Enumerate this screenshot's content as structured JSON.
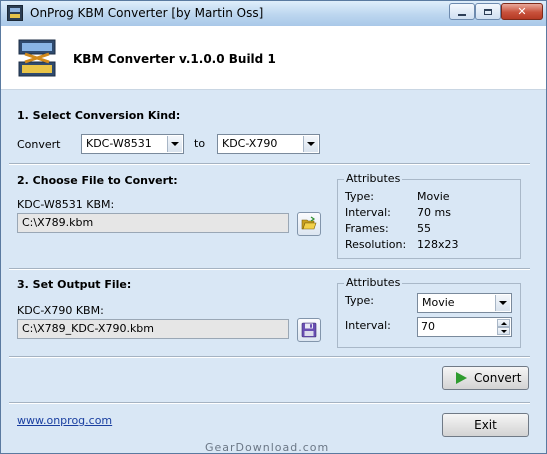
{
  "window": {
    "title": "OnProg KBM Converter [by Martin Oss]"
  },
  "header": {
    "title": "KBM Converter v.1.0.0 Build 1"
  },
  "section1": {
    "title": "1. Select Conversion Kind:",
    "convert_label": "Convert",
    "from_value": "KDC-W8531",
    "to_label": "to",
    "to_value": "KDC-X790"
  },
  "section2": {
    "title": "2. Choose File to Convert:",
    "file_label": "KDC-W8531 KBM:",
    "file_value": "C:\\X789.kbm",
    "attributes": {
      "legend": "Attributes",
      "rows": [
        {
          "key": "Type:",
          "value": "Movie"
        },
        {
          "key": "Interval:",
          "value": "70 ms"
        },
        {
          "key": "Frames:",
          "value": "55"
        },
        {
          "key": "Resolution:",
          "value": "128x23"
        }
      ]
    }
  },
  "section3": {
    "title": "3. Set Output File:",
    "file_label": "KDC-X790 KBM:",
    "file_value": "C:\\X789_KDC-X790.kbm",
    "attributes": {
      "legend": "Attributes",
      "type_label": "Type:",
      "type_value": "Movie",
      "interval_label": "Interval:",
      "interval_value": "70"
    }
  },
  "footer": {
    "convert_button": "Convert",
    "exit_button": "Exit",
    "link": "www.onprog.com",
    "watermark": "GearDownload.com"
  },
  "colors": {
    "window_bg": "#d9e7f5",
    "link": "#1a3fa0",
    "convert_icon": "#2f9c2f"
  },
  "icons": {
    "app": "kbm-app-icon",
    "header_logo": "kbm-logo-icon",
    "open": "folder-open-icon",
    "save": "floppy-save-icon",
    "convert": "play-icon"
  }
}
